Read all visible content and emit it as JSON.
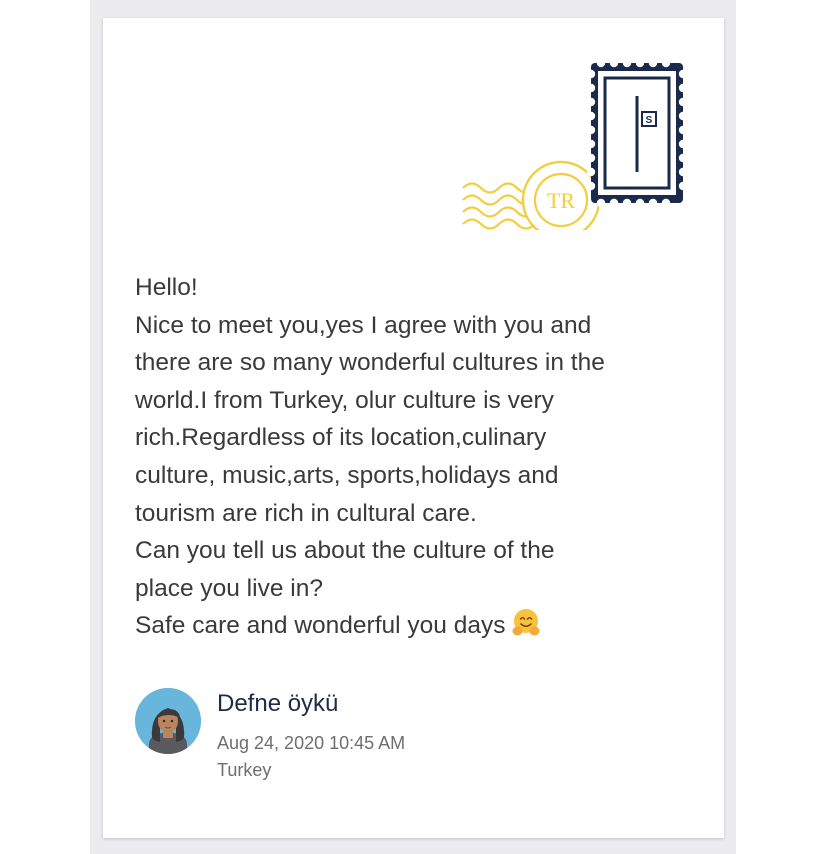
{
  "postcard": {
    "stamp": {
      "postmark_text": "TR",
      "stamp_corner_text": "S",
      "postmark_color": "#f2cd3c",
      "stamp_color": "#1b2a4a"
    },
    "message_lines": [
      "Hello!",
      "Nice to meet you,yes I agree with you and",
      "there  are so many wonderful cultures in the",
      "world.I from Turkey, olur culture is very",
      "rich.Regardless of its  location,culinary",
      "culture, music,arts, sports,holidays and",
      "tourism are rich in cultural care.",
      "Can you tell us about the culture of the",
      "place you live in?",
      "Safe care and wonderful you days"
    ],
    "emoji_icon": "hugging-face-icon",
    "author": {
      "name": "Defne öykü",
      "date": "Aug 24, 2020 10:45 AM",
      "country": "Turkey",
      "avatar_icon": "user-avatar-illustration",
      "avatar_bg": "#69b6dd"
    }
  }
}
